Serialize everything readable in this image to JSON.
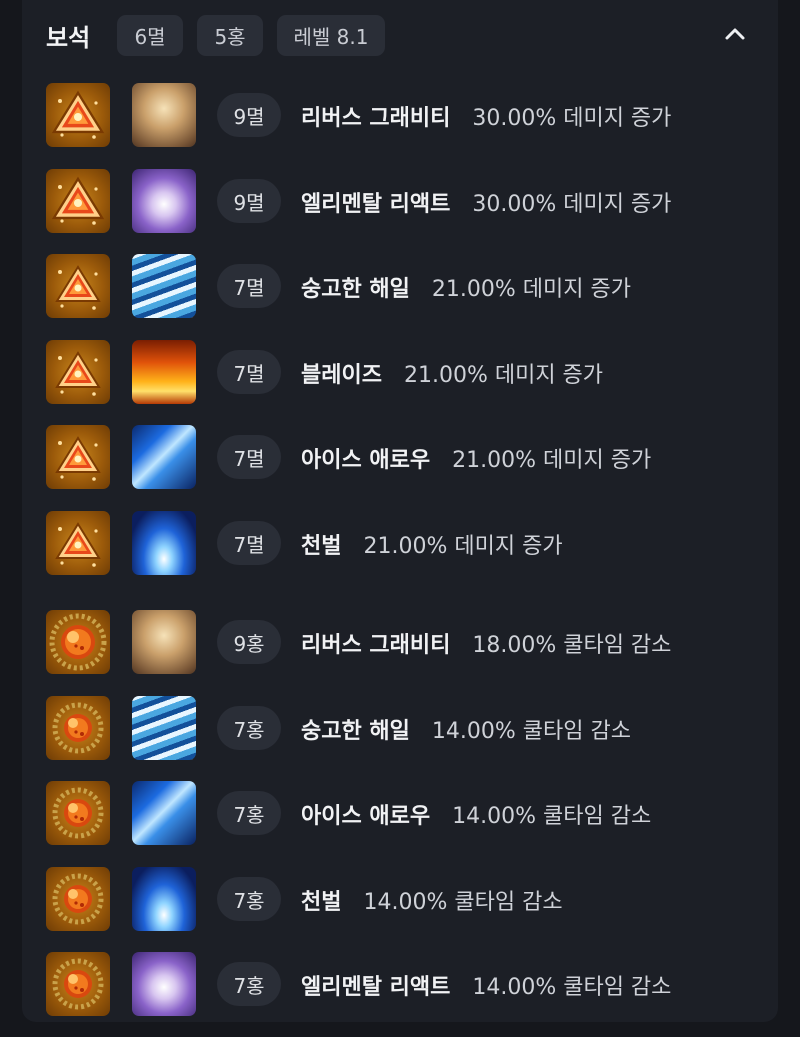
{
  "header": {
    "title": "보석",
    "chips": [
      "6멸",
      "5홍",
      "레벨 8.1"
    ]
  },
  "gems": [
    {
      "gem_type": "doom-gem-large",
      "skill_icon": "gravity-icon",
      "level": "9멸",
      "skill": "리버스 그래비티",
      "effect": "30.00% 데미지 증가"
    },
    {
      "gem_type": "doom-gem-large",
      "skill_icon": "elemental-icon",
      "level": "9멸",
      "skill": "엘리멘탈 리액트",
      "effect": "30.00% 데미지 증가"
    },
    {
      "gem_type": "doom-gem",
      "skill_icon": "wave-icon",
      "level": "7멸",
      "skill": "숭고한 해일",
      "effect": "21.00% 데미지 증가"
    },
    {
      "gem_type": "doom-gem",
      "skill_icon": "blaze-icon",
      "level": "7멸",
      "skill": "블레이즈",
      "effect": "21.00% 데미지 증가"
    },
    {
      "gem_type": "doom-gem",
      "skill_icon": "ice-arrow-icon",
      "level": "7멸",
      "skill": "아이스 애로우",
      "effect": "21.00% 데미지 증가"
    },
    {
      "gem_type": "doom-gem",
      "skill_icon": "judgment-icon",
      "level": "7멸",
      "skill": "천벌",
      "effect": "21.00% 데미지 증가"
    },
    {
      "gem_type": "bloom-gem-large",
      "skill_icon": "gravity-icon",
      "level": "9홍",
      "skill": "리버스 그래비티",
      "effect": "18.00% 쿨타임 감소"
    },
    {
      "gem_type": "bloom-gem",
      "skill_icon": "wave-icon",
      "level": "7홍",
      "skill": "숭고한 해일",
      "effect": "14.00% 쿨타임 감소"
    },
    {
      "gem_type": "bloom-gem",
      "skill_icon": "ice-arrow-icon",
      "level": "7홍",
      "skill": "아이스 애로우",
      "effect": "14.00% 쿨타임 감소"
    },
    {
      "gem_type": "bloom-gem",
      "skill_icon": "judgment-icon",
      "level": "7홍",
      "skill": "천벌",
      "effect": "14.00% 쿨타임 감소"
    },
    {
      "gem_type": "bloom-gem",
      "skill_icon": "elemental-icon",
      "level": "7홍",
      "skill": "엘리멘탈 리액트",
      "effect": "14.00% 쿨타임 감소"
    }
  ],
  "colors": {
    "background": "#15171c",
    "panel": "#1c1f26",
    "chip": "#2a2e37",
    "text": "#f1f2f4",
    "muted": "#cfd2d8"
  }
}
